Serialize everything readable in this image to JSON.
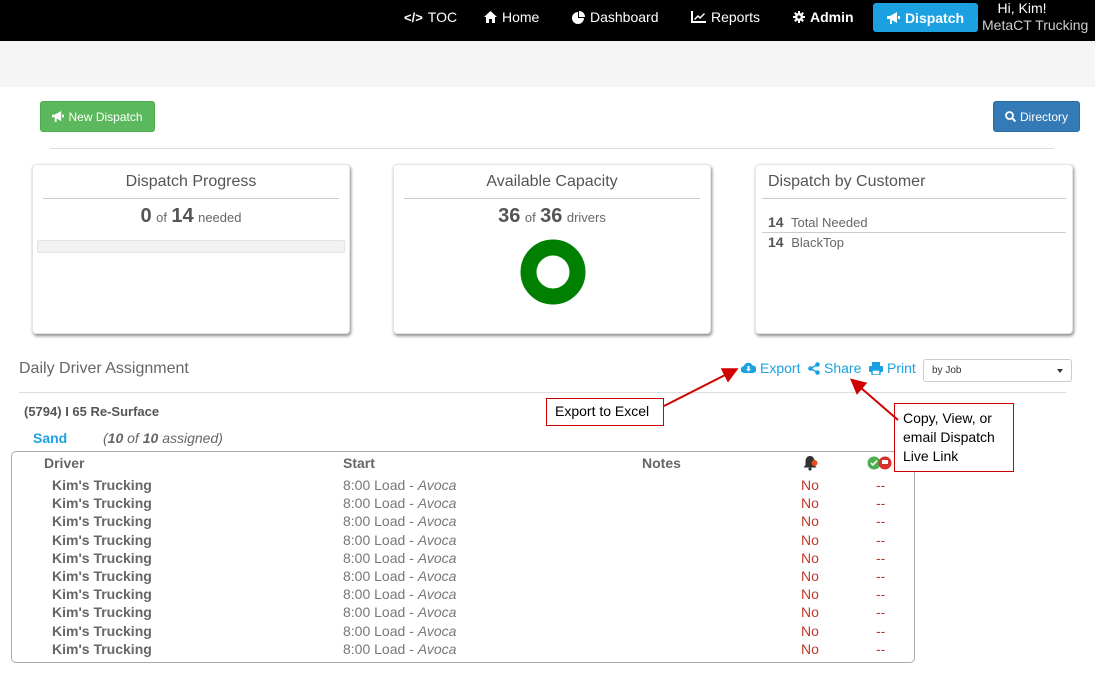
{
  "nav": {
    "toc": "TOC",
    "home": "Home",
    "dashboard": "Dashboard",
    "reports": "Reports",
    "admin": "Admin",
    "dispatch": "Dispatch",
    "greeting": "Hi, Kim!",
    "org": "MetaCT Trucking"
  },
  "toolbar": {
    "new_dispatch": "New Dispatch",
    "directory": "Directory"
  },
  "progress_panel": {
    "title": "Dispatch Progress",
    "count": "0",
    "of": "of",
    "total": "14",
    "suffix": "needed",
    "progress": 0
  },
  "capacity_panel": {
    "title": "Available Capacity",
    "count": "36",
    "of": "of",
    "total": "36",
    "suffix": "drivers",
    "ring_color": "#008000"
  },
  "customer_panel": {
    "title": "Dispatch by Customer",
    "rows": [
      {
        "count": "14",
        "label": "Total Needed"
      },
      {
        "count": "14",
        "label": "BlackTop"
      }
    ]
  },
  "assignment": {
    "title": "Daily Driver Assignment",
    "export": "Export",
    "share": "Share",
    "print": "Print",
    "group_by": "by Job",
    "job": "(5794) I 65 Re-Surface",
    "material": "Sand",
    "assigned_count": "10",
    "assigned_of": "of",
    "assigned_total": "10",
    "assigned_label": "assigned",
    "columns": {
      "driver": "Driver",
      "start": "Start",
      "notes": "Notes"
    },
    "rows": [
      {
        "driver": "Kim's Trucking",
        "start": "8:00 Load - ",
        "place": "Avoca",
        "notified": "No",
        "msg": "--"
      },
      {
        "driver": "Kim's Trucking",
        "start": "8:00 Load - ",
        "place": "Avoca",
        "notified": "No",
        "msg": "--"
      },
      {
        "driver": "Kim's Trucking",
        "start": "8:00 Load - ",
        "place": "Avoca",
        "notified": "No",
        "msg": "--"
      },
      {
        "driver": "Kim's Trucking",
        "start": "8:00 Load - ",
        "place": "Avoca",
        "notified": "No",
        "msg": "--"
      },
      {
        "driver": "Kim's Trucking",
        "start": "8:00 Load - ",
        "place": "Avoca",
        "notified": "No",
        "msg": "--"
      },
      {
        "driver": "Kim's Trucking",
        "start": "8:00 Load - ",
        "place": "Avoca",
        "notified": "No",
        "msg": "--"
      },
      {
        "driver": "Kim's Trucking",
        "start": "8:00 Load - ",
        "place": "Avoca",
        "notified": "No",
        "msg": "--"
      },
      {
        "driver": "Kim's Trucking",
        "start": "8:00 Load - ",
        "place": "Avoca",
        "notified": "No",
        "msg": "--"
      },
      {
        "driver": "Kim's Trucking",
        "start": "8:00 Load - ",
        "place": "Avoca",
        "notified": "No",
        "msg": "--"
      },
      {
        "driver": "Kim's Trucking",
        "start": "8:00 Load - ",
        "place": "Avoca",
        "notified": "No",
        "msg": "--"
      }
    ]
  },
  "callouts": {
    "export": "Export to Excel",
    "share": "Copy, View, or email Dispatch Live Link"
  }
}
